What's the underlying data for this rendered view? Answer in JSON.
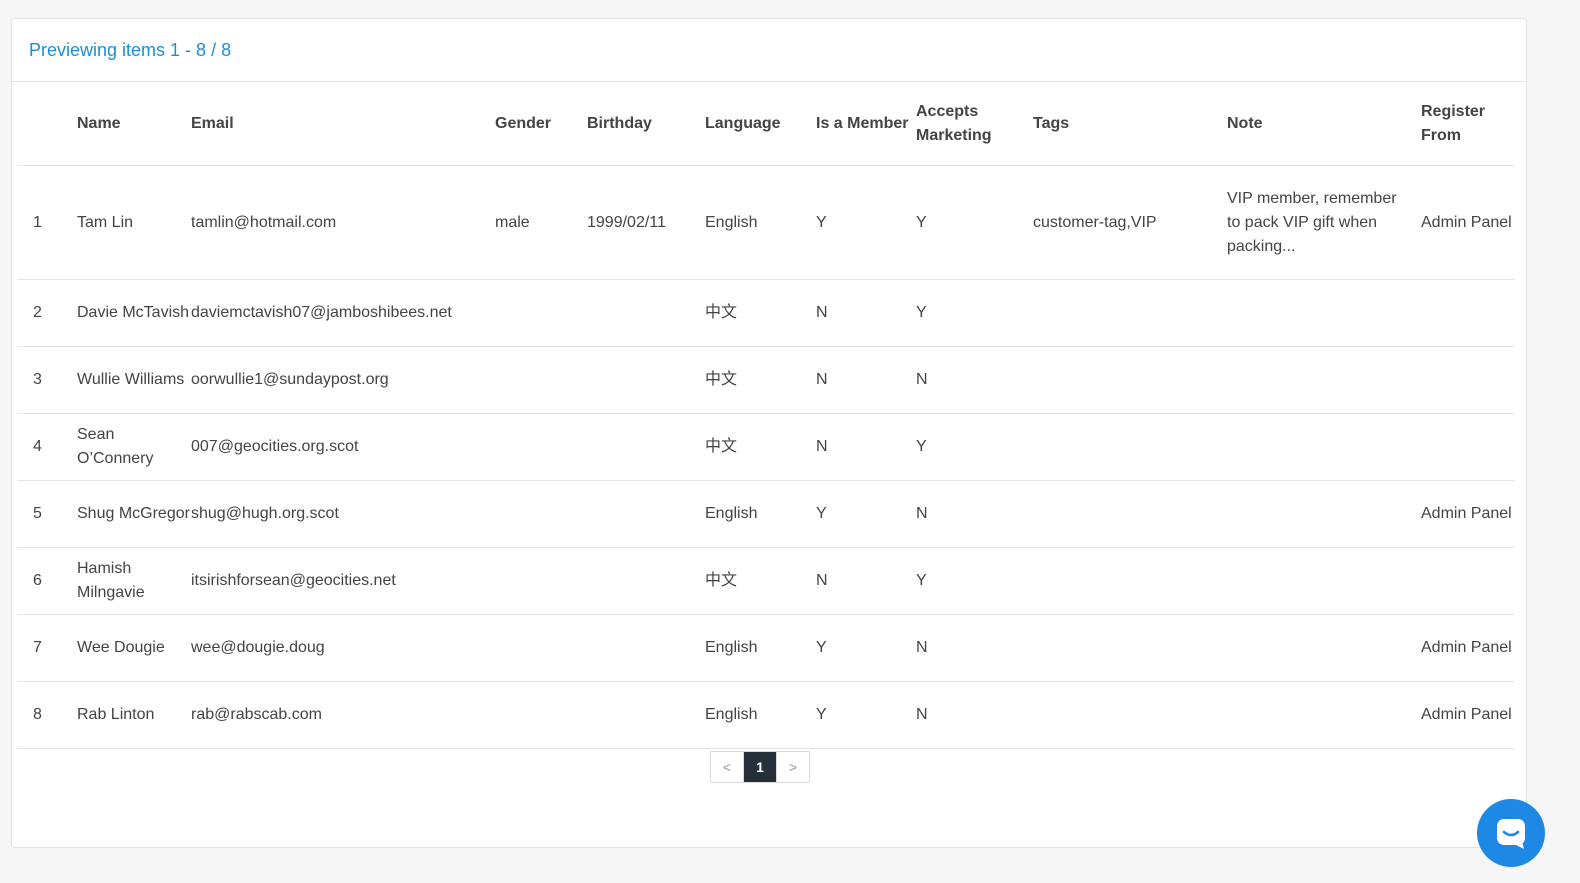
{
  "header": {
    "preview_text": "Previewing items 1 - 8 / 8"
  },
  "table": {
    "columns": {
      "index": "",
      "name": "Name",
      "email": "Email",
      "gender": "Gender",
      "birthday": "Birthday",
      "language": "Language",
      "is_member": "Is a Member",
      "accepts_marketing": "Accepts Marketing",
      "tags": "Tags",
      "note": "Note",
      "register_from": "Register From"
    },
    "rows": [
      {
        "index": "1",
        "name": "Tam Lin",
        "email": "tamlin@hotmail.com",
        "gender": "male",
        "birthday": "1999/02/11",
        "language": "English",
        "is_member": "Y",
        "accepts_marketing": "Y",
        "tags": "customer-tag,VIP",
        "note": "VIP member, remember to pack VIP gift when packing...",
        "register_from": "Admin Panel"
      },
      {
        "index": "2",
        "name": "Davie McTavish",
        "email": "daviemctavish07@jamboshibees.net",
        "gender": "",
        "birthday": "",
        "language": "中文",
        "is_member": "N",
        "accepts_marketing": "Y",
        "tags": "",
        "note": "",
        "register_from": ""
      },
      {
        "index": "3",
        "name": "Wullie Williams",
        "email": "oorwullie1@sundaypost.org",
        "gender": "",
        "birthday": "",
        "language": "中文",
        "is_member": "N",
        "accepts_marketing": "N",
        "tags": "",
        "note": "",
        "register_from": ""
      },
      {
        "index": "4",
        "name": "Sean O’Connery",
        "email": "007@geocities.org.scot",
        "gender": "",
        "birthday": "",
        "language": "中文",
        "is_member": "N",
        "accepts_marketing": "Y",
        "tags": "",
        "note": "",
        "register_from": ""
      },
      {
        "index": "5",
        "name": "Shug McGregor",
        "email": "shug@hugh.org.scot",
        "gender": "",
        "birthday": "",
        "language": "English",
        "is_member": "Y",
        "accepts_marketing": "N",
        "tags": "",
        "note": "",
        "register_from": "Admin Panel"
      },
      {
        "index": "6",
        "name": "Hamish Milngavie",
        "email": "itsirishforsean@geocities.net",
        "gender": "",
        "birthday": "",
        "language": "中文",
        "is_member": "N",
        "accepts_marketing": "Y",
        "tags": "",
        "note": "",
        "register_from": ""
      },
      {
        "index": "7",
        "name": "Wee Dougie",
        "email": "wee@dougie.doug",
        "gender": "",
        "birthday": "",
        "language": "English",
        "is_member": "Y",
        "accepts_marketing": "N",
        "tags": "",
        "note": "",
        "register_from": "Admin Panel"
      },
      {
        "index": "8",
        "name": "Rab Linton",
        "email": "rab@rabscab.com",
        "gender": "",
        "birthday": "",
        "language": "English",
        "is_member": "Y",
        "accepts_marketing": "N",
        "tags": "",
        "note": "",
        "register_from": "Admin Panel"
      }
    ]
  },
  "pagination": {
    "prev_label": "<",
    "current_page": "1",
    "next_label": ">"
  },
  "chat": {
    "icon": "chat-icon",
    "color": "#1e88e5"
  },
  "colors": {
    "accent": "#1b8ed8",
    "active_page": "#26303a"
  }
}
